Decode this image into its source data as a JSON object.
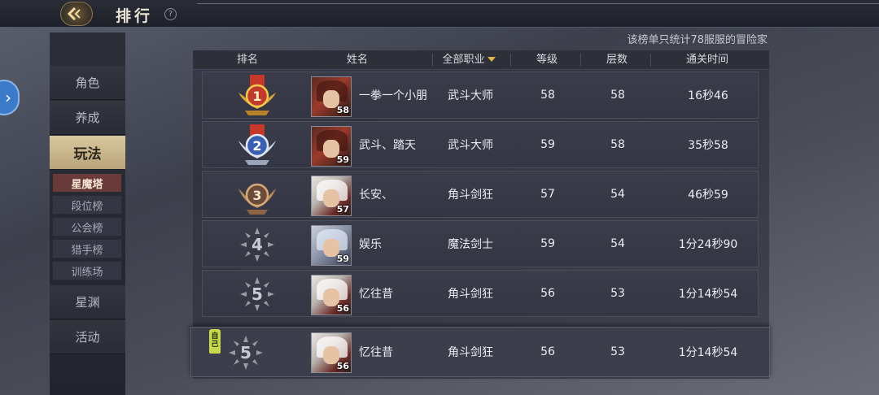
{
  "header": {
    "title": "排行",
    "back_icon": "back-arrow-icon",
    "help_symbol": "?"
  },
  "sidebar": {
    "toggle_symbol": "›",
    "items": [
      {
        "label": "角色",
        "active": false
      },
      {
        "label": "养成",
        "active": false
      },
      {
        "label": "玩法",
        "active": true
      },
      {
        "label": "星渊",
        "active": false
      },
      {
        "label": "活动",
        "active": false
      }
    ],
    "submenu": [
      {
        "label": "星魔塔",
        "active": true
      },
      {
        "label": "段位榜",
        "active": false
      },
      {
        "label": "公会榜",
        "active": false
      },
      {
        "label": "猎手榜",
        "active": false
      },
      {
        "label": "训练场",
        "active": false
      }
    ]
  },
  "note": "该榜单只统计78服服的冒险家",
  "table": {
    "headers": {
      "rank": "排名",
      "name": "姓名",
      "job": "全部职业",
      "level": "等级",
      "floor": "层数",
      "time": "通关时间"
    },
    "rows": [
      {
        "rank": "1",
        "name": "一拳一个小朋",
        "avatar_level": "58",
        "job": "武斗大师",
        "level": "58",
        "floor": "58",
        "time": "16秒46"
      },
      {
        "rank": "2",
        "name": "武斗、踏天",
        "avatar_level": "59",
        "job": "武斗大师",
        "level": "59",
        "floor": "58",
        "time": "35秒58"
      },
      {
        "rank": "3",
        "name": "长安、",
        "avatar_level": "57",
        "job": "角斗剑狂",
        "level": "57",
        "floor": "54",
        "time": "46秒59"
      },
      {
        "rank": "4",
        "name": "娱乐",
        "avatar_level": "59",
        "job": "魔法剑士",
        "level": "59",
        "floor": "54",
        "time": "1分24秒90"
      },
      {
        "rank": "5",
        "name": "忆往昔",
        "avatar_level": "56",
        "job": "角斗剑狂",
        "level": "56",
        "floor": "53",
        "time": "1分14秒54"
      }
    ],
    "self_row": {
      "tag": "自己",
      "rank": "5",
      "name": "忆往昔",
      "avatar_level": "56",
      "job": "角斗剑狂",
      "level": "56",
      "floor": "53",
      "time": "1分14秒54"
    }
  },
  "colors": {
    "accent_gold": "#e0b64d",
    "menu_active": "#d8c89e",
    "submenu_active": "#6a3a3a",
    "self_tag": "#c6d94a"
  }
}
